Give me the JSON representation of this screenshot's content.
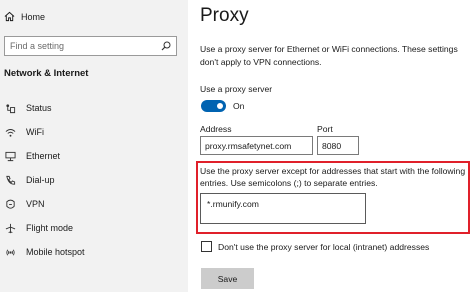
{
  "sidebar": {
    "home_label": "Home",
    "search_placeholder": "Find a setting",
    "section_title": "Network & Internet",
    "items": [
      {
        "label": "Status",
        "icon": "status-icon"
      },
      {
        "label": "WiFi",
        "icon": "wifi-icon"
      },
      {
        "label": "Ethernet",
        "icon": "ethernet-icon"
      },
      {
        "label": "Dial-up",
        "icon": "dialup-icon"
      },
      {
        "label": "VPN",
        "icon": "vpn-icon"
      },
      {
        "label": "Flight mode",
        "icon": "airplane-icon"
      },
      {
        "label": "Mobile hotspot",
        "icon": "hotspot-icon"
      }
    ]
  },
  "main": {
    "title": "Proxy",
    "description": "Use a proxy server for Ethernet or WiFi connections. These settings don't apply to VPN connections.",
    "use_proxy_label": "Use a proxy server",
    "toggle_state": "On",
    "address_label": "Address",
    "address_value": "proxy.rmsafetynet.com",
    "port_label": "Port",
    "port_value": "8080",
    "exceptions_description": "Use the proxy server except for addresses that start with the following entries. Use semicolons (;) to separate entries.",
    "exceptions_value": "*.rmunify.com",
    "local_bypass_label": "Don't use the proxy server for local (intranet) addresses",
    "local_bypass_checked": false,
    "save_label": "Save"
  },
  "colors": {
    "accent": "#0063b1",
    "highlight_border": "#e0202a",
    "sidebar_bg": "#f2f2f2"
  }
}
